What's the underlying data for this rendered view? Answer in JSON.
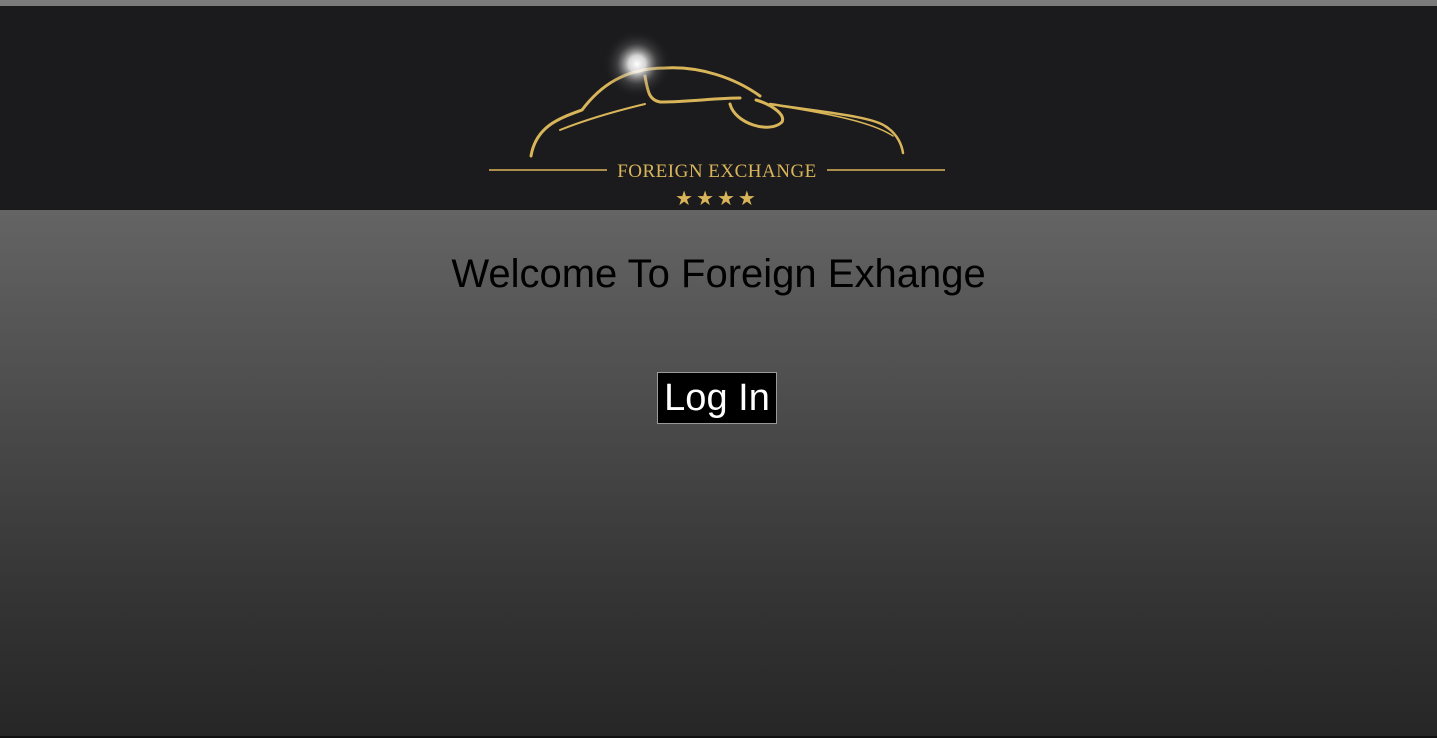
{
  "header": {
    "logo_text": "FOREIGN EXCHANGE",
    "logo_stars": "★★★★",
    "logo_color": "#d9b55a"
  },
  "main": {
    "welcome_text": "Welcome To Foreign Exhange",
    "login_label": "Log In"
  }
}
